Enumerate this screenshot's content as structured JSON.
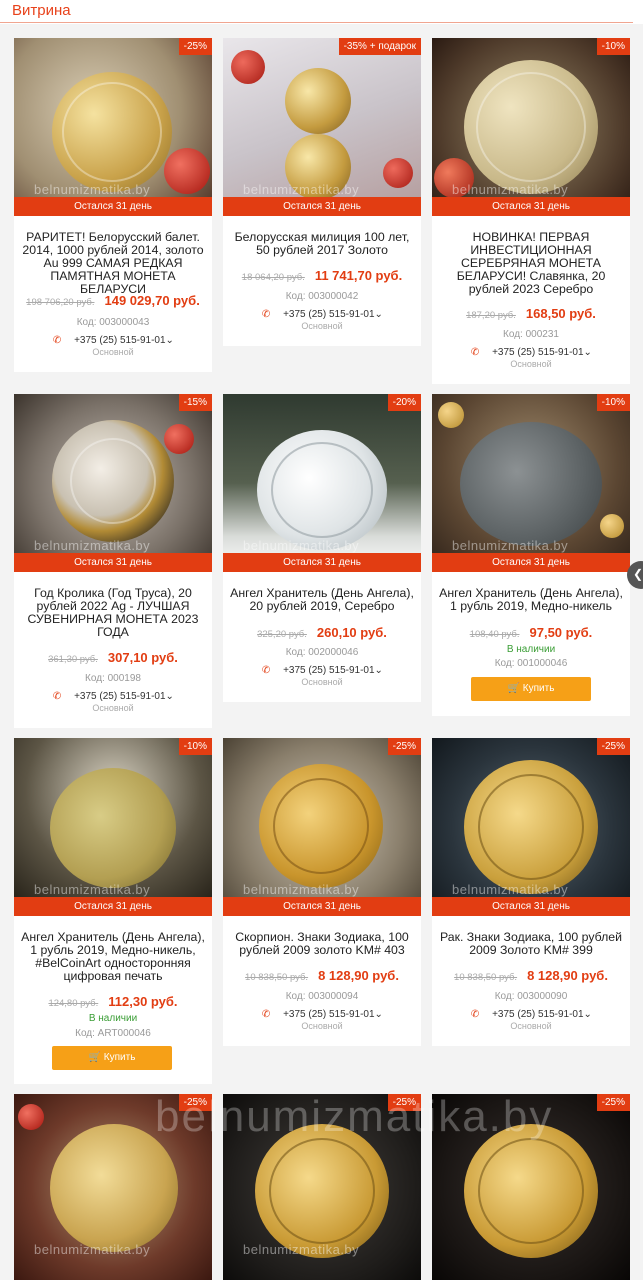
{
  "header": {
    "title": "Витрина"
  },
  "watermark": "belnumizmatika.by",
  "colors": {
    "accent": "#e23d12",
    "buy": "#f6a017",
    "instock": "#3a9d35"
  },
  "products": [
    {
      "discount": "-25%",
      "timer": "Остался 31 день",
      "name": "РАРИТЕТ! Белорусский балет. 2014, 1000 рублей 2014, золото Au 999 САМАЯ РЕДКАЯ ПАМЯТНАЯ МОНЕТА БЕЛАРУСИ",
      "old_price": "198 706,20 руб.",
      "price": "149 029,70 руб.",
      "code": "Код: 003000043",
      "phone": "+375 (25) 515-91-01⌄",
      "phone_sub": "Основной"
    },
    {
      "discount": "-35% + подарок",
      "timer": "Остался 31 день",
      "name": "Белорусская милиция 100 лет, 50 рублей 2017 Золото",
      "old_price": "18 064,20 руб.",
      "price": "11 741,70 руб.",
      "code": "Код: 003000042",
      "phone": "+375 (25) 515-91-01⌄",
      "phone_sub": "Основной"
    },
    {
      "discount": "-10%",
      "timer": "Остался 31 день",
      "name": "НОВИНКА! ПЕРВАЯ ИНВЕСТИЦИОННАЯ СЕРЕБРЯНАЯ МОНЕТА БЕЛАРУСИ! Славянка, 20 рублей 2023 Серебро",
      "old_price": "187,20 руб.",
      "price": "168,50 руб.",
      "code": "Код: 000231",
      "phone": "+375 (25) 515-91-01⌄",
      "phone_sub": "Основной"
    },
    {
      "discount": "-15%",
      "timer": "Остался 31 день",
      "name": "Год Кролика (Год Труса), 20 рублей 2022 Ag - ЛУЧШАЯ СУВЕНИРНАЯ МОНЕТА 2023 ГОДА",
      "old_price": "361,30 руб.",
      "price": "307,10 руб.",
      "code": "Код: 000198",
      "phone": "+375 (25) 515-91-01⌄",
      "phone_sub": "Основной"
    },
    {
      "discount": "-20%",
      "timer": "Остался 31 день",
      "name": "Ангел Хранитель (День Ангела), 20 рублей 2019, Серебро",
      "old_price": "325,20 руб.",
      "price": "260,10 руб.",
      "code": "Код: 002000046",
      "phone": "+375 (25) 515-91-01⌄",
      "phone_sub": "Основной"
    },
    {
      "discount": "-10%",
      "timer": "Остался 31 день",
      "name": "Ангел Хранитель (День Ангела), 1 рубль 2019, Медно-никель",
      "old_price": "108,40 руб.",
      "price": "97,50 руб.",
      "in_stock": "В наличии",
      "code": "Код: 001000046",
      "buy": "Купить"
    },
    {
      "discount": "-10%",
      "timer": "Остался 31 день",
      "name": "Ангел Хранитель (День Ангела), 1 рубль 2019, Медно-никель, #BelCoinArt односторонняя цифровая печать",
      "old_price": "124,80 руб.",
      "price": "112,30 руб.",
      "in_stock": "В наличии",
      "code": "Код: ART000046",
      "buy": "Купить"
    },
    {
      "discount": "-25%",
      "timer": "Остался 31 день",
      "name": "Скорпион. Знаки Зодиака, 100 рублей 2009 золото KM# 403",
      "old_price": "10 838,50 руб.",
      "price": "8 128,90 руб.",
      "code": "Код: 003000094",
      "phone": "+375 (25) 515-91-01⌄",
      "phone_sub": "Основной"
    },
    {
      "discount": "-25%",
      "timer": "Остался 31 день",
      "name": "Рак. Знаки Зодиака, 100 рублей 2009 Золото KM# 399",
      "old_price": "10 838,50 руб.",
      "price": "8 128,90 руб.",
      "code": "Код: 003000090",
      "phone": "+375 (25) 515-91-01⌄",
      "phone_sub": "Основной"
    },
    {
      "discount": "-25%"
    },
    {
      "discount": "-25%"
    },
    {
      "discount": "-25%"
    }
  ]
}
